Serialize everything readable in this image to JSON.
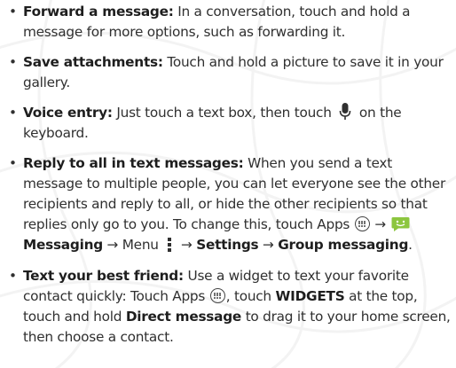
{
  "items": [
    {
      "bullet": "•",
      "title": "Forward a message:",
      "t1": "In a conversation, touch and hold a message for more options, such as forwarding it."
    },
    {
      "bullet": "•",
      "title": "Save attachments:",
      "t1": "Touch and hold a picture to save it in your gallery."
    },
    {
      "bullet": "•",
      "title": "Voice entry:",
      "t1": "Just touch a text box, then touch",
      "t2": "on the keyboard."
    },
    {
      "bullet": "•",
      "title": "Reply to all in text messages:",
      "t1": "When you send a text message to multiple people, you can let everyone see the other recipients and reply to all, or hide the other recipients so that replies only go to you. To change this, touch Apps",
      "arrow1": "→",
      "b1": "Messaging",
      "arrow2": "→ Menu",
      "arrow3": "→",
      "b2": "Settings",
      "arrow4": "→",
      "b3": "Group messaging",
      "end": "."
    },
    {
      "bullet": "•",
      "title": "Text your best friend:",
      "t1": "Use a widget to text your favorite contact quickly: Touch Apps",
      "t2": ", touch",
      "b1": "WIDGETS",
      "t3": "at the top, touch and hold",
      "b2": "Direct message",
      "t4": "to drag it to your home screen, then choose a contact."
    }
  ],
  "icons": {
    "mic": "microphone-icon",
    "apps": "apps-icon",
    "messaging": "messaging-app-icon",
    "menu": "menu-dots-icon"
  },
  "colors": {
    "text": "#303030",
    "messaging_icon": "#8cc63f"
  }
}
